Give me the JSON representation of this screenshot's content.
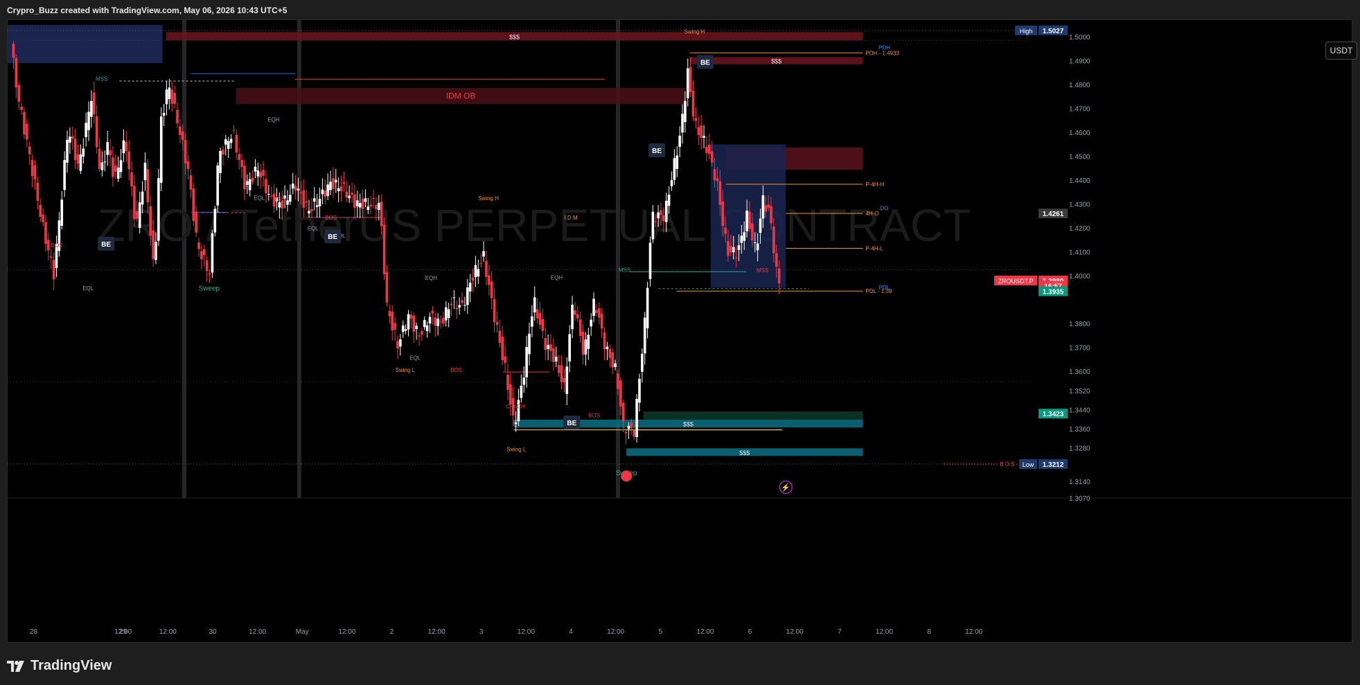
{
  "header": {
    "credit": "Crypro_Buzz created with TradingView.com, May 06, 2026 10:43 UTC+5"
  },
  "toolbar": {
    "currency_label": "USDT"
  },
  "footer": {
    "brand": "TradingView"
  },
  "colors": {
    "up": "#ffffff",
    "down": "#f23645",
    "zone_red": "#6b1520",
    "zone_teal": "#0a6e84",
    "zone_green": "#0e3a2a",
    "zone_blue": "#1e2a5c",
    "orange": "#f7931a",
    "green": "#22ab94",
    "blue": "#2962ff"
  },
  "chart_data": {
    "type": "candlestick",
    "symbol": "ZRO / TetherUS PERPETUAL CONTRACT",
    "watermark": "ZRO / TetherUS PERPETUAL CONTRACT",
    "ylim": [
      1.307,
      1.507
    ],
    "xlim": [
      -5,
      1140
    ],
    "y_ticks": [
      "1.5000",
      "1.4900",
      "1.4800",
      "1.4700",
      "1.4600",
      "1.4500",
      "1.4400",
      "1.4300",
      "1.4200",
      "1.4100",
      "1.4000",
      "1.3800",
      "1.3700",
      "1.3600",
      "1.3520",
      "1.3440",
      "1.3360",
      "1.3280",
      "1.3140",
      "1.3070"
    ],
    "x_ticks": [
      {
        "label": "28",
        "x": 24
      },
      {
        "label": "12:00",
        "x": 124
      },
      {
        "label": "29",
        "x": 124
      },
      {
        "label": "12:00",
        "x": 174
      },
      {
        "label": "30",
        "x": 224
      },
      {
        "label": "12:00",
        "x": 274
      },
      {
        "label": "May",
        "x": 324
      },
      {
        "label": "12:00",
        "x": 374
      },
      {
        "label": "2",
        "x": 424
      },
      {
        "label": "12:00",
        "x": 474
      },
      {
        "label": "3",
        "x": 524
      },
      {
        "label": "12:00",
        "x": 574
      },
      {
        "label": "4",
        "x": 624
      },
      {
        "label": "12:00",
        "x": 674
      },
      {
        "label": "5",
        "x": 724
      },
      {
        "label": "12:00",
        "x": 774
      },
      {
        "label": "6",
        "x": 824
      },
      {
        "label": "12:00",
        "x": 874
      },
      {
        "label": "7",
        "x": 924
      },
      {
        "label": "12:00",
        "x": 974
      },
      {
        "label": "8",
        "x": 1024
      },
      {
        "label": "12:00",
        "x": 1074
      }
    ],
    "anchors": [
      {
        "i": 0,
        "p": 1.497
      },
      {
        "i": 8,
        "p": 1.475
      },
      {
        "i": 20,
        "p": 1.452
      },
      {
        "i": 36,
        "p": 1.42
      },
      {
        "i": 48,
        "p": 1.401
      },
      {
        "i": 56,
        "p": 1.43
      },
      {
        "i": 64,
        "p": 1.462
      },
      {
        "i": 76,
        "p": 1.445
      },
      {
        "i": 90,
        "p": 1.475
      },
      {
        "i": 100,
        "p": 1.442
      },
      {
        "i": 108,
        "p": 1.455
      },
      {
        "i": 116,
        "p": 1.44
      },
      {
        "i": 128,
        "p": 1.457
      },
      {
        "i": 140,
        "p": 1.42
      },
      {
        "i": 150,
        "p": 1.445
      },
      {
        "i": 160,
        "p": 1.4
      },
      {
        "i": 168,
        "p": 1.465
      },
      {
        "i": 176,
        "p": 1.48
      },
      {
        "i": 186,
        "p": 1.465
      },
      {
        "i": 198,
        "p": 1.444
      },
      {
        "i": 208,
        "p": 1.413
      },
      {
        "i": 222,
        "p": 1.401
      },
      {
        "i": 232,
        "p": 1.45
      },
      {
        "i": 248,
        "p": 1.46
      },
      {
        "i": 262,
        "p": 1.437
      },
      {
        "i": 276,
        "p": 1.445
      },
      {
        "i": 290,
        "p": 1.432
      },
      {
        "i": 304,
        "p": 1.43
      },
      {
        "i": 318,
        "p": 1.438
      },
      {
        "i": 332,
        "p": 1.427
      },
      {
        "i": 344,
        "p": 1.432
      },
      {
        "i": 358,
        "p": 1.439
      },
      {
        "i": 372,
        "p": 1.436
      },
      {
        "i": 386,
        "p": 1.43
      },
      {
        "i": 400,
        "p": 1.43
      },
      {
        "i": 412,
        "p": 1.43
      },
      {
        "i": 420,
        "p": 1.387
      },
      {
        "i": 432,
        "p": 1.371
      },
      {
        "i": 444,
        "p": 1.383
      },
      {
        "i": 456,
        "p": 1.375
      },
      {
        "i": 468,
        "p": 1.383
      },
      {
        "i": 480,
        "p": 1.38
      },
      {
        "i": 492,
        "p": 1.389
      },
      {
        "i": 504,
        "p": 1.387
      },
      {
        "i": 516,
        "p": 1.4
      },
      {
        "i": 528,
        "p": 1.408
      },
      {
        "i": 540,
        "p": 1.383
      },
      {
        "i": 552,
        "p": 1.361
      },
      {
        "i": 562,
        "p": 1.337
      },
      {
        "i": 572,
        "p": 1.357
      },
      {
        "i": 584,
        "p": 1.39
      },
      {
        "i": 596,
        "p": 1.372
      },
      {
        "i": 608,
        "p": 1.365
      },
      {
        "i": 618,
        "p": 1.353
      },
      {
        "i": 628,
        "p": 1.39
      },
      {
        "i": 640,
        "p": 1.367
      },
      {
        "i": 652,
        "p": 1.39
      },
      {
        "i": 664,
        "p": 1.37
      },
      {
        "i": 676,
        "p": 1.36
      },
      {
        "i": 684,
        "p": 1.337
      },
      {
        "i": 696,
        "p": 1.335
      },
      {
        "i": 708,
        "p": 1.38
      },
      {
        "i": 716,
        "p": 1.425
      },
      {
        "i": 730,
        "p": 1.425
      },
      {
        "i": 740,
        "p": 1.445
      },
      {
        "i": 748,
        "p": 1.46
      },
      {
        "i": 756,
        "p": 1.485
      },
      {
        "i": 764,
        "p": 1.463
      },
      {
        "i": 776,
        "p": 1.455
      },
      {
        "i": 788,
        "p": 1.44
      },
      {
        "i": 800,
        "p": 1.41
      },
      {
        "i": 812,
        "p": 1.41
      },
      {
        "i": 822,
        "p": 1.425
      },
      {
        "i": 832,
        "p": 1.41
      },
      {
        "i": 840,
        "p": 1.432
      },
      {
        "i": 848,
        "p": 1.425
      },
      {
        "i": 856,
        "p": 1.398
      }
    ],
    "zones": [
      {
        "name": "zone-sss-top",
        "label": "$$$",
        "x1": 172,
        "x2": 950,
        "y1": 1.502,
        "y2": 1.4985,
        "fill": "#6b1520"
      },
      {
        "name": "zone-sss-pdh",
        "label": "$$$",
        "x1": 757,
        "x2": 950,
        "y1": 1.4915,
        "y2": 1.4885,
        "fill": "#6b1520"
      },
      {
        "name": "zone-idm-ob",
        "label": "IDM OB",
        "x1": 250,
        "x2": 752,
        "y1": 1.4786,
        "y2": 1.4718,
        "fill": "#4a0f17"
      },
      {
        "name": "zone-red-right",
        "label": "",
        "x1": 797,
        "x2": 950,
        "y1": 1.4537,
        "y2": 1.4443,
        "fill": "#5a121c"
      },
      {
        "name": "zone-green-bottom",
        "label": "",
        "x1": 705,
        "x2": 950,
        "y1": 1.3432,
        "y2": 1.3398,
        "fill": "#0e3a2a"
      },
      {
        "name": "zone-teal-sss",
        "label": "$$$",
        "x1": 560,
        "x2": 950,
        "y1": 1.3398,
        "y2": 1.3365,
        "fill": "#0a6e84"
      },
      {
        "name": "zone-teal-low",
        "label": "$$$",
        "x1": 686,
        "x2": 950,
        "y1": 1.3278,
        "y2": 1.3246,
        "fill": "#0a6e84"
      },
      {
        "name": "zone-blue-left",
        "label": "",
        "x1": -5,
        "x2": 168,
        "y1": 1.505,
        "y2": 1.489,
        "fill": "#1e2a5c"
      },
      {
        "name": "zone-blue-right",
        "label": "",
        "x1": 780,
        "x2": 864,
        "y1": 1.455,
        "y2": 1.395,
        "fill": "#1a2550"
      }
    ],
    "levels": [
      {
        "name": "level-pdh",
        "label": "PDH - 1.4933",
        "price": 1.4933,
        "x1": 757,
        "x2": 950,
        "color": "#f7931a"
      },
      {
        "name": "level-p4h-h",
        "label": "P-4H-H",
        "price": 1.4383,
        "x1": 797,
        "x2": 950,
        "color": "#f7931a"
      },
      {
        "name": "level-4h-o",
        "label": "4H-O",
        "price": 1.4261,
        "x1": 864,
        "x2": 950,
        "color": "#f7931a"
      },
      {
        "name": "level-p4h-l",
        "label": "P-4H-L",
        "price": 1.4115,
        "x1": 864,
        "x2": 950,
        "color": "#f7931a"
      },
      {
        "name": "level-pdl",
        "label": "PDL - 1.39",
        "price": 1.3936,
        "x1": 742,
        "x2": 950,
        "color": "#f7931a"
      },
      {
        "name": "level-bos-low",
        "label": "B O S - 1.3212",
        "price": 1.3212,
        "x1": 1040,
        "x2": 1100,
        "color": "#f23645"
      }
    ],
    "annotations": [
      {
        "label": "MSS",
        "x": 100,
        "y": 1.4816,
        "color": "#22ab94"
      },
      {
        "label": "BOS",
        "x": 50,
        "y": 1.412,
        "color": "#f23645"
      },
      {
        "label": "EQL",
        "x": 85,
        "y": 1.394,
        "color": "#9aa0a6"
      },
      {
        "label": "Sweep",
        "x": 220,
        "y": 1.3938,
        "color": "#22ab94"
      },
      {
        "label": "EQH",
        "x": 292,
        "y": 1.4645,
        "color": "#9aa0a6"
      },
      {
        "label": "EQL",
        "x": 276,
        "y": 1.4318,
        "color": "#9aa0a6"
      },
      {
        "label": "MSS",
        "x": 298,
        "y": 1.4315,
        "color": "#f23645"
      },
      {
        "label": "BOS",
        "x": 356,
        "y": 1.4235,
        "color": "#f23645"
      },
      {
        "label": "EQL",
        "x": 336,
        "y": 1.419,
        "color": "#9aa0a6"
      },
      {
        "label": "EQL",
        "x": 366,
        "y": 1.416,
        "color": "#9aa0a6"
      },
      {
        "label": "Swing H",
        "x": 532,
        "y": 1.4316,
        "color": "#f7931a"
      },
      {
        "label": "I D M",
        "x": 624,
        "y": 1.4235,
        "color": "#f7931a"
      },
      {
        "label": "EQH",
        "x": 468,
        "y": 1.3983,
        "color": "#9aa0a6"
      },
      {
        "label": "EQL",
        "x": 450,
        "y": 1.3648,
        "color": "#9aa0a6"
      },
      {
        "label": "Swing L",
        "x": 439,
        "y": 1.3598,
        "color": "#f7931a"
      },
      {
        "label": "BOS",
        "x": 496,
        "y": 1.3598,
        "color": "#f23645"
      },
      {
        "label": "CHoCH",
        "x": 562,
        "y": 1.3445,
        "color": "#f23645"
      },
      {
        "label": "EQH",
        "x": 608,
        "y": 1.3985,
        "color": "#9aa0a6"
      },
      {
        "label": "MSS",
        "x": 684,
        "y": 1.4016,
        "color": "#22ab94"
      },
      {
        "label": "BOS",
        "x": 650,
        "y": 1.3407,
        "color": "#f23645"
      },
      {
        "label": "Swing L",
        "x": 563,
        "y": 1.3265,
        "color": "#f7931a"
      },
      {
        "label": "Sweep",
        "x": 686,
        "y": 1.3165,
        "color": "#22ab94"
      },
      {
        "label": "Swing H",
        "x": 762,
        "y": 1.5013,
        "color": "#f7931a"
      },
      {
        "label": "MSS",
        "x": 838,
        "y": 1.4015,
        "color": "#f23645"
      },
      {
        "label": "PDH",
        "x": 974,
        "y": 1.4947,
        "color": "#2196f3"
      },
      {
        "label": "DO",
        "x": 974,
        "y": 1.4275,
        "color": "#2196f3"
      },
      {
        "label": "PDL",
        "x": 974,
        "y": 1.3942,
        "color": "#2196f3"
      }
    ],
    "be_markers": [
      {
        "label": "BE",
        "x": 105,
        "y": 1.4134
      },
      {
        "label": "BE",
        "x": 358,
        "y": 1.4165
      },
      {
        "label": "BE",
        "x": 625,
        "y": 1.3386
      },
      {
        "label": "BE",
        "x": 720,
        "y": 1.4525
      },
      {
        "label": "BE",
        "x": 774,
        "y": 1.4895
      }
    ],
    "price_labels": [
      {
        "label": "High",
        "value": "1.5027",
        "y": 1.5027,
        "bg": "#1f3a6e"
      },
      {
        "label": "",
        "value": "1.4261",
        "y": 1.4261,
        "bg": "#3a3a3a"
      },
      {
        "label": "ZROUSDT.P",
        "value": "1.3980",
        "y": 1.398,
        "bg": "#f23645"
      },
      {
        "label": "",
        "value": "16:57",
        "y": 1.3958,
        "bg": "#f23645"
      },
      {
        "label": "",
        "value": "1.3935",
        "y": 1.3935,
        "bg": "#089981"
      },
      {
        "label": "",
        "value": "1.3423",
        "y": 1.3423,
        "bg": "#089981"
      },
      {
        "label": "Low",
        "value": "1.3212",
        "y": 1.3212,
        "bg": "#1f3a6e"
      }
    ]
  }
}
